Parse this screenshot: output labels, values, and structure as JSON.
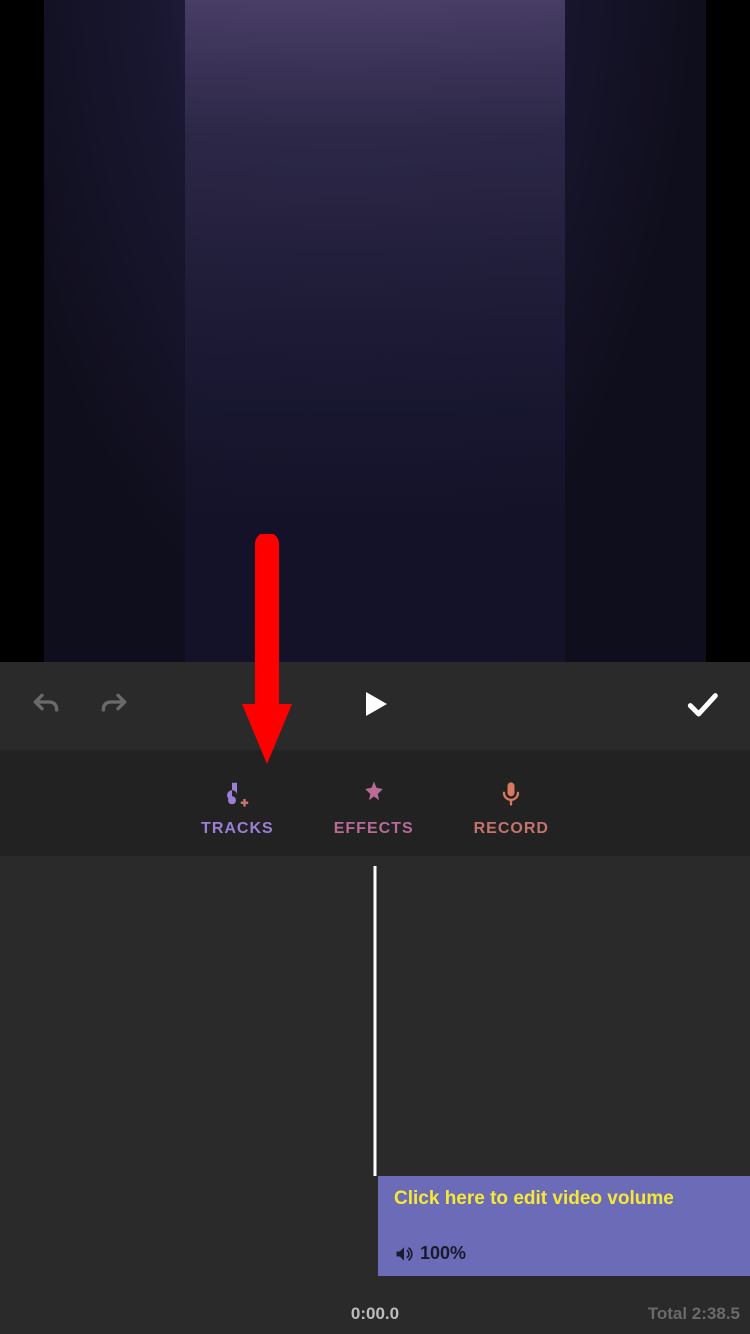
{
  "tabs": {
    "tracks": {
      "label": "TRACKS"
    },
    "effects": {
      "label": "EFFECTS"
    },
    "record": {
      "label": "RECORD"
    }
  },
  "clip": {
    "hint": "Click here to edit video volume",
    "volume": "100%"
  },
  "timeline": {
    "current": "0:00.0",
    "total_label": "Total",
    "total_value": "2:38.5"
  },
  "colors": {
    "tracks": "#9b7fd4",
    "effects": "#b86b94",
    "record": "#c4736f",
    "clip_bg": "#6c6bb8",
    "clip_text": "#f5e935",
    "arrow": "#ff0000"
  }
}
